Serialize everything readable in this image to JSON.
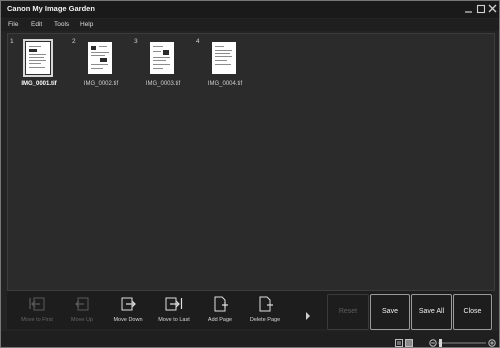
{
  "window": {
    "title": "Canon My Image Garden"
  },
  "menu": [
    "File",
    "Edit",
    "Tools",
    "Help"
  ],
  "pages": [
    {
      "number": "1",
      "filename": "IMG_0001.tif",
      "selected": true
    },
    {
      "number": "2",
      "filename": "IMG_0002.tif",
      "selected": false
    },
    {
      "number": "3",
      "filename": "IMG_0003.tif",
      "selected": false
    },
    {
      "number": "4",
      "filename": "IMG_0004.tif",
      "selected": false
    }
  ],
  "toolbar": {
    "move_to_first": {
      "label": "Move to First",
      "icon": "move-to-first-icon",
      "enabled": false
    },
    "move_up": {
      "label": "Move Up",
      "icon": "move-up-icon",
      "enabled": false
    },
    "move_down": {
      "label": "Move Down",
      "icon": "move-down-icon",
      "enabled": true
    },
    "move_to_last": {
      "label": "Move to Last",
      "icon": "move-to-last-icon",
      "enabled": true
    },
    "add_page": {
      "label": "Add Page",
      "icon": "add-page-icon",
      "enabled": true
    },
    "delete_page": {
      "label": "Delete Page",
      "icon": "delete-page-icon",
      "enabled": true
    }
  },
  "actions": {
    "reset": {
      "label": "Reset",
      "enabled": false
    },
    "save": {
      "label": "Save",
      "enabled": true
    },
    "save_all": {
      "label": "Save All",
      "enabled": true
    },
    "close": {
      "label": "Close",
      "enabled": true
    }
  },
  "status": {
    "view_options": [
      "list-view-icon",
      "detail-view-icon"
    ],
    "zoom": {
      "minus_icon": "zoom-out-icon",
      "plus_icon": "zoom-in-icon"
    }
  },
  "colors": {
    "background": "#242424",
    "panel": "#2b2b2b",
    "text": "#e6e6e6",
    "disabled": "#676767"
  }
}
